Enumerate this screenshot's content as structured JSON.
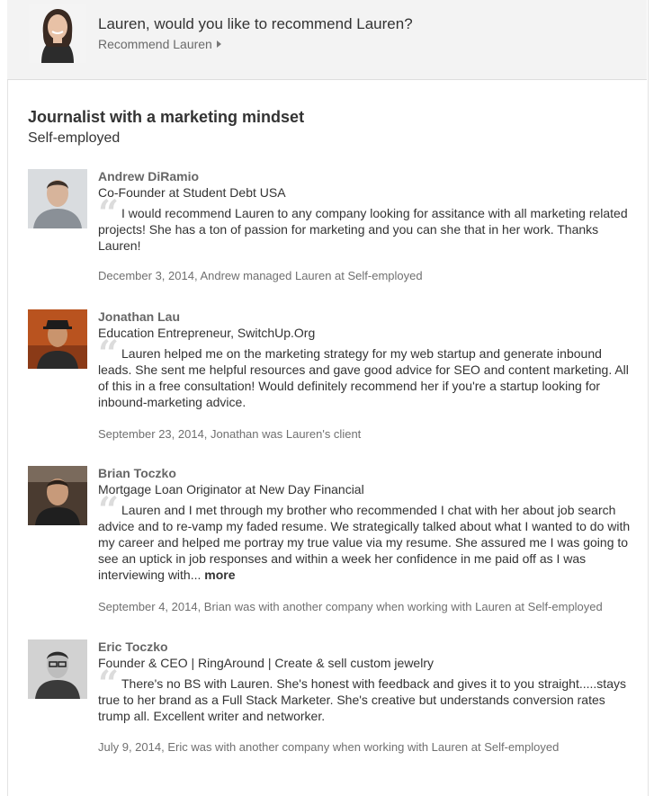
{
  "prompt": {
    "question": "Lauren, would you like to recommend Lauren?",
    "link_label": "Recommend Lauren"
  },
  "position": {
    "title": "Journalist with a marketing mindset",
    "company": "Self-employed"
  },
  "recommendations": [
    {
      "name": "Andrew DiRamio",
      "headline": "Co-Founder at Student Debt USA",
      "text": "I would recommend Lauren to any company looking for assitance with all marketing related projects! She has a ton of passion for marketing and you can she that in her work. Thanks Lauren!",
      "date_line": "December 3, 2014, Andrew managed Lauren at Self-employed"
    },
    {
      "name": "Jonathan Lau",
      "headline": "Education Entrepreneur, SwitchUp.Org",
      "text": "Lauren helped me on the marketing strategy for my web startup and generate inbound leads. She sent me helpful resources and gave good advice for SEO and content marketing. All of this in a free consultation! Would definitely recommend her if you're a startup looking for inbound-marketing advice.",
      "date_line": "September 23, 2014, Jonathan was Lauren's client"
    },
    {
      "name": "Brian Toczko",
      "headline": "Mortgage Loan Originator at New Day Financial",
      "text": "Lauren and I met through my brother who recommended I chat with her about job search advice and to re-vamp my faded resume. We strategically talked about what I wanted to do with my career and helped me portray my true value via my resume. She assured me I was going to see an uptick in job responses and within a week her confidence in me paid off as I was interviewing with...",
      "more_label": "more",
      "date_line": "September 4, 2014, Brian was with another company when working with Lauren at Self-employed"
    },
    {
      "name": "Eric Toczko",
      "headline": "Founder & CEO | RingAround | Create & sell custom jewelry",
      "text": "There's no BS with Lauren. She's honest with feedback and gives it to you straight.....stays true to her brand as a Full Stack Marketer. She's creative but understands conversion rates trump all. Excellent writer and networker.",
      "date_line": "July 9, 2014, Eric was with another company when working with Lauren at Self-employed"
    }
  ]
}
